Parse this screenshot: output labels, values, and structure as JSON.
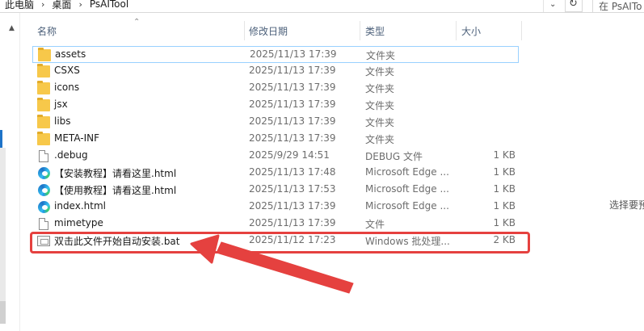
{
  "breadcrumb": {
    "items": [
      "此电脑",
      "桌面",
      "PsAITool"
    ],
    "separator": "›",
    "dropdown_icon": "chevron-down-icon",
    "refresh_icon": "refresh-icon"
  },
  "search": {
    "placeholder": "在 PsAITo"
  },
  "columns": {
    "name": "名称",
    "date": "修改日期",
    "type": "类型",
    "size": "大小"
  },
  "files": [
    {
      "name": "assets",
      "date": "2025/11/13 17:39",
      "type": "文件夹",
      "size": "",
      "icon": "folder-icon"
    },
    {
      "name": "CSXS",
      "date": "2025/11/13 17:39",
      "type": "文件夹",
      "size": "",
      "icon": "folder-icon"
    },
    {
      "name": "icons",
      "date": "2025/11/13 17:39",
      "type": "文件夹",
      "size": "",
      "icon": "folder-icon"
    },
    {
      "name": "jsx",
      "date": "2025/11/13 17:39",
      "type": "文件夹",
      "size": "",
      "icon": "folder-icon"
    },
    {
      "name": "libs",
      "date": "2025/11/13 17:39",
      "type": "文件夹",
      "size": "",
      "icon": "folder-icon"
    },
    {
      "name": "META-INF",
      "date": "2025/11/13 17:39",
      "type": "文件夹",
      "size": "",
      "icon": "folder-icon"
    },
    {
      "name": ".debug",
      "date": "2025/9/29 14:51",
      "type": "DEBUG 文件",
      "size": "1 KB",
      "icon": "file-icon"
    },
    {
      "name": "【安装教程】请看这里.html",
      "date": "2025/11/13 17:48",
      "type": "Microsoft Edge ...",
      "size": "1 KB",
      "icon": "edge-icon"
    },
    {
      "name": "【使用教程】请看这里.html",
      "date": "2025/11/13 17:53",
      "type": "Microsoft Edge ...",
      "size": "1 KB",
      "icon": "edge-icon"
    },
    {
      "name": "index.html",
      "date": "2025/11/13 17:39",
      "type": "Microsoft Edge ...",
      "size": "1 KB",
      "icon": "edge-icon"
    },
    {
      "name": "mimetype",
      "date": "2025/11/13 17:39",
      "type": "文件",
      "size": "1 KB",
      "icon": "file-icon"
    },
    {
      "name": "双击此文件开始自动安装.bat",
      "date": "2025/11/12 17:23",
      "type": "Windows 批处理...",
      "size": "2 KB",
      "icon": "bat-file-icon"
    }
  ],
  "preview": {
    "text": "选择要预"
  },
  "colors": {
    "highlight": "#e5413f",
    "selection_border": "#99d1ff",
    "folder": "#f7c84a"
  }
}
